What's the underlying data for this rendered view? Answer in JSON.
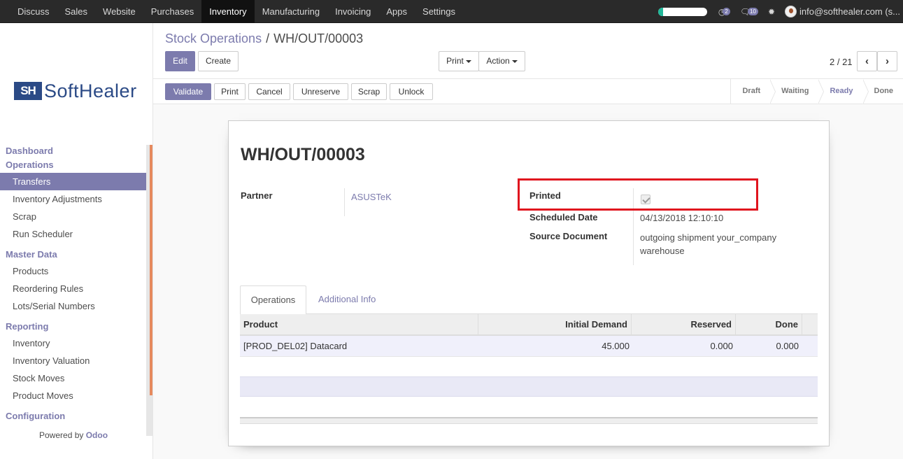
{
  "topbar": {
    "menu": [
      "Discuss",
      "Sales",
      "Website",
      "Purchases",
      "Inventory",
      "Manufacturing",
      "Invoicing",
      "Apps",
      "Settings"
    ],
    "active_menu": "Inventory",
    "progress_fraction": 0.1,
    "activity_count": "2",
    "messages_count": "10",
    "user_label": "info@softhealer.com (s..."
  },
  "sidebar": {
    "logo_mark": "SH",
    "logo_text": "SoftHealer",
    "sections": [
      {
        "title": "Dashboard",
        "items": []
      },
      {
        "title": "Operations",
        "items": [
          "Transfers",
          "Inventory Adjustments",
          "Scrap",
          "Run Scheduler"
        ]
      },
      {
        "title": "Master Data",
        "items": [
          "Products",
          "Reordering Rules",
          "Lots/Serial Numbers"
        ]
      },
      {
        "title": "Reporting",
        "items": [
          "Inventory",
          "Inventory Valuation",
          "Stock Moves",
          "Product Moves"
        ]
      },
      {
        "title": "Configuration",
        "items": []
      }
    ],
    "active_item": "Transfers",
    "powered_by_prefix": "Powered by",
    "powered_by_brand": "Odoo"
  },
  "control_panel": {
    "breadcrumb_parent": "Stock Operations",
    "breadcrumb_sep": "/",
    "breadcrumb_current": "WH/OUT/00003",
    "edit_label": "Edit",
    "create_label": "Create",
    "print_label": "Print",
    "action_label": "Action",
    "pager": "2 / 21"
  },
  "statusbar": {
    "buttons": [
      "Validate",
      "Print",
      "Cancel",
      "Unreserve",
      "Scrap",
      "Unlock"
    ],
    "stages": [
      "Draft",
      "Waiting",
      "Ready",
      "Done"
    ],
    "current_stage": "Ready"
  },
  "form": {
    "title": "WH/OUT/00003",
    "partner_label": "Partner",
    "partner_value": "ASUSTeK",
    "printed_label": "Printed",
    "printed_checked": true,
    "scheduled_date_label": "Scheduled Date",
    "scheduled_date_value": "04/13/2018 12:10:10",
    "source_document_label": "Source Document",
    "source_document_line1": "outgoing shipment your_company",
    "source_document_line2": "warehouse",
    "tabs": [
      "Operations",
      "Additional Info"
    ],
    "columns": [
      "Product",
      "Initial Demand",
      "Reserved",
      "Done"
    ],
    "rows": [
      {
        "product": "[PROD_DEL02] Datacard",
        "initial_demand": "45.000",
        "reserved": "0.000",
        "done": "0.000"
      }
    ]
  },
  "colors": {
    "brand": "#7c7bad",
    "highlight": "#e0141e",
    "navbar": "#2a2a2a"
  }
}
